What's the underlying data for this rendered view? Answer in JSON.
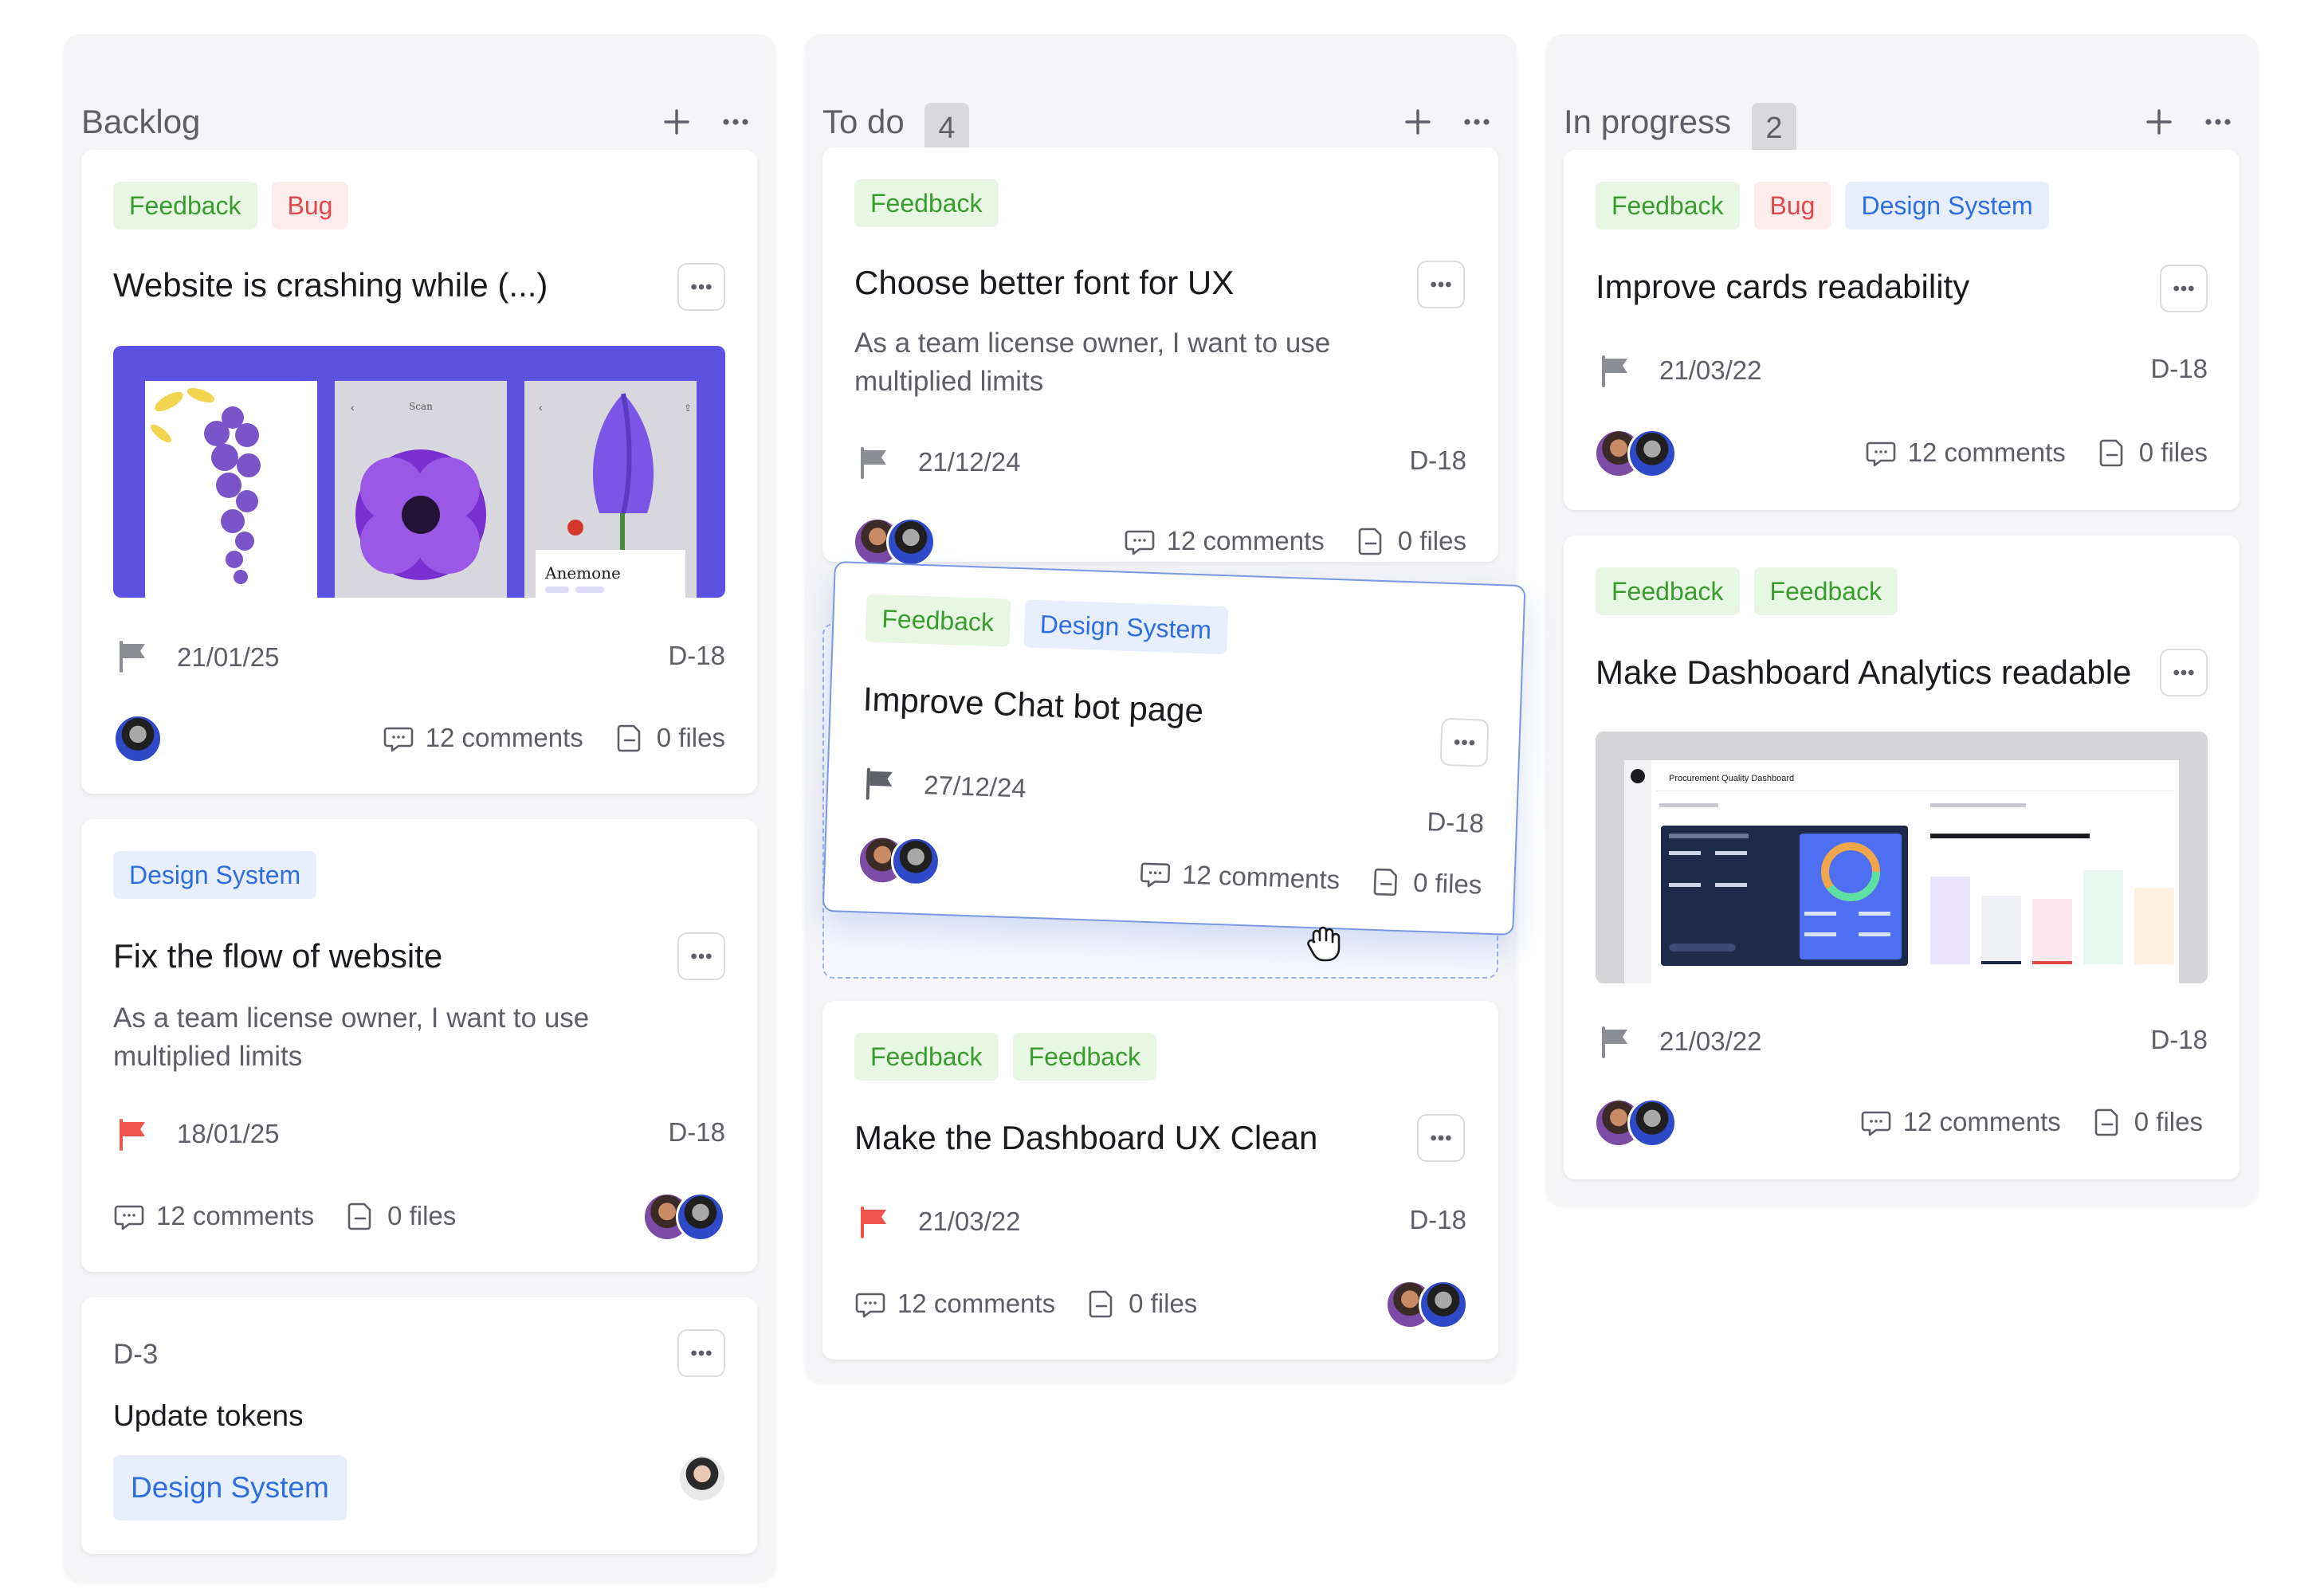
{
  "colors": {
    "feedback_fg": "#3a9b2f",
    "feedback_bg": "#e8f6e4",
    "bug_fg": "#e0494a",
    "bug_bg": "#fdecec",
    "ds_fg": "#2f6ee0",
    "ds_bg": "#e7efff",
    "flag_gray": "#8a8d94",
    "flag_red": "#f0524c",
    "drag_border": "#7b98e3"
  },
  "columns": [
    {
      "title": "Backlog",
      "count": "",
      "cards": [
        {
          "tags": [
            "Feedback",
            "Bug"
          ],
          "title": "Website is crashing while (...)",
          "has_image": true,
          "date": "21/01/25",
          "id": "D-18",
          "comments": "12 comments",
          "files": "0 files",
          "flag": "gray",
          "image_caption": "Anemone",
          "image_screen_title": "Scan"
        },
        {
          "tags": [
            "Design System"
          ],
          "title": "Fix the flow of website",
          "desc": "As a team license owner, I want to use multiplied limits",
          "date": "18/01/25",
          "id": "D-18",
          "comments": "12 comments",
          "files": "0 files",
          "flag": "red"
        },
        {
          "id_top": "D-3",
          "title": "Update tokens",
          "tags": [
            "Design System"
          ]
        }
      ]
    },
    {
      "title": "To do",
      "count": "4",
      "cards": [
        {
          "tags": [
            "Feedback"
          ],
          "title": "Choose better font for UX",
          "desc": "As a team license owner, I want to use multiplied limits",
          "date": "21/12/24",
          "id": "D-18",
          "comments": "12 comments",
          "files": "0 files",
          "flag": "gray"
        },
        {
          "tags": [
            "Feedback",
            "Design System"
          ],
          "title": "Improve Chat bot page",
          "date": "27/12/24",
          "id": "D-18",
          "comments": "12 comments",
          "files": "0 files",
          "flag": "gray",
          "dragging": true
        },
        {
          "tags": [
            "Feedback",
            "Feedback"
          ],
          "title": "Make the Dashboard UX Clean",
          "date": "21/03/22",
          "id": "D-18",
          "comments": "12 comments",
          "files": "0 files",
          "flag": "red"
        }
      ]
    },
    {
      "title": "In progress",
      "count": "2",
      "cards": [
        {
          "tags": [
            "Feedback",
            "Bug",
            "Design System"
          ],
          "title": "Improve cards readability",
          "date": "21/03/22",
          "id": "D-18",
          "comments": "12 comments",
          "files": "0 files",
          "flag": "gray"
        },
        {
          "tags": [
            "Feedback",
            "Feedback"
          ],
          "title": "Make Dashboard Analytics readable",
          "has_image": true,
          "date": "21/03/22",
          "id": "D-18",
          "comments": "12 comments",
          "files": "0 files",
          "flag": "gray",
          "image_caption": "Procurement Quality Dashboard"
        }
      ]
    }
  ]
}
